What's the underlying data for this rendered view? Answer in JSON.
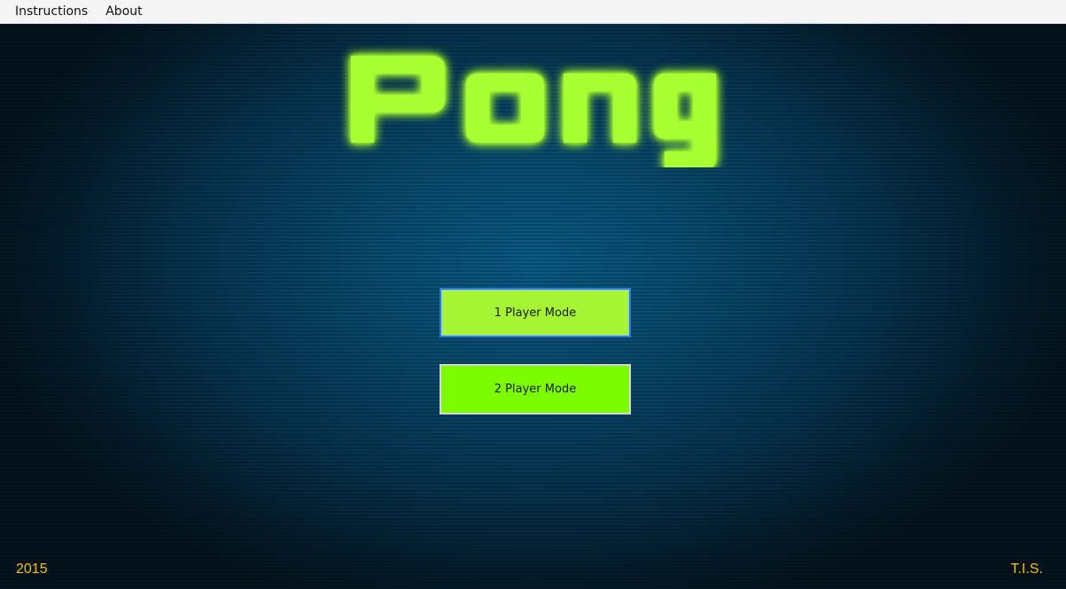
{
  "menubar": {
    "items": [
      {
        "label": "Instructions"
      },
      {
        "label": "About"
      }
    ]
  },
  "title": {
    "text": "Pong",
    "glow_color": "#a6ff2e"
  },
  "buttons": {
    "one_player": "1 Player Mode",
    "two_player": "2 Player Mode"
  },
  "footer": {
    "year": "2015",
    "author": "T.I.S."
  },
  "colors": {
    "background": "#0a5a85",
    "button_one": "#a6f534",
    "button_two": "#7cfc00",
    "footer_text": "#f5c400"
  }
}
